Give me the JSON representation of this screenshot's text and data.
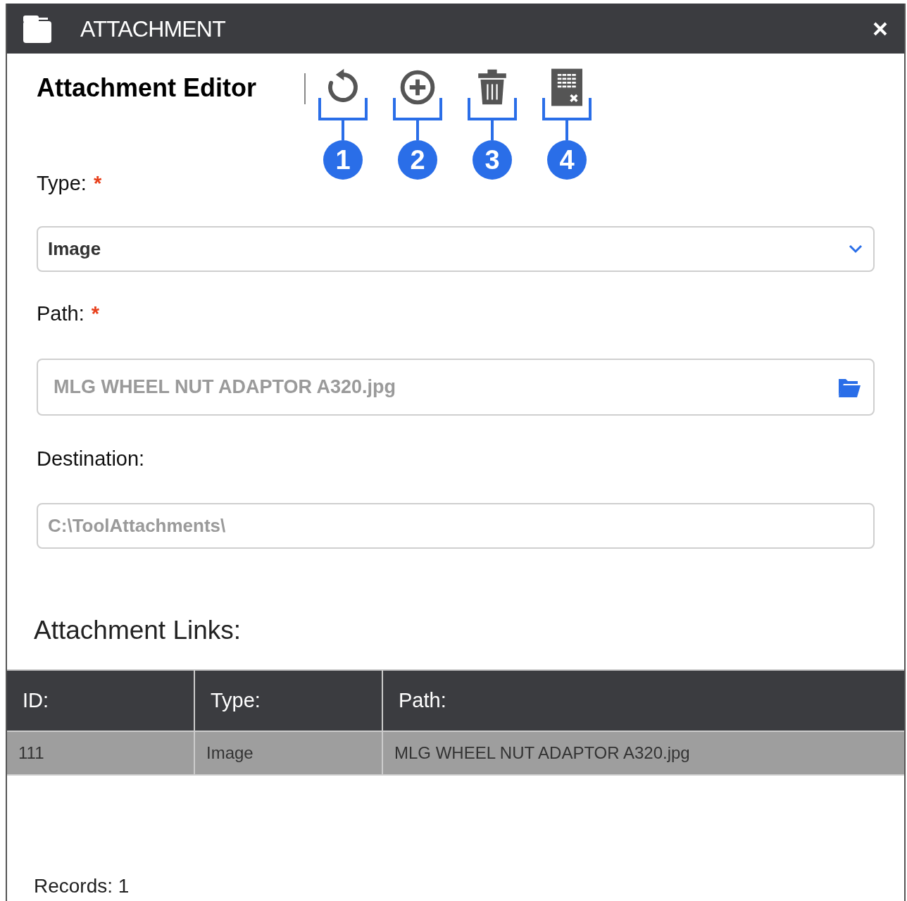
{
  "window": {
    "title": "ATTACHMENT"
  },
  "editor": {
    "title": "Attachment Editor",
    "tools": [
      {
        "kind": "refresh",
        "callout": "1"
      },
      {
        "kind": "add",
        "callout": "2"
      },
      {
        "kind": "delete",
        "callout": "3"
      },
      {
        "kind": "export",
        "callout": "4"
      }
    ],
    "fields": [
      {
        "kind": "select",
        "label": "Type:",
        "marker": "*",
        "value": "Image",
        "disabled": false
      },
      {
        "kind": "file",
        "label": "Path:",
        "marker": "*",
        "value": "MLG WHEEL NUT ADAPTOR A320.jpg",
        "disabled": true
      },
      {
        "kind": "text",
        "label": "Destination:",
        "value": "C:\\ToolAttachments\\",
        "disabled": true
      }
    ]
  },
  "links": {
    "title": "Attachment Links:",
    "columns": [
      "ID:",
      "Type:",
      "Path:"
    ],
    "rows": [
      {
        "cells": [
          "111",
          "Image",
          "MLG WHEEL NUT ADAPTOR A320.jpg"
        ],
        "selected": true
      }
    ],
    "records": "Records: 1"
  }
}
